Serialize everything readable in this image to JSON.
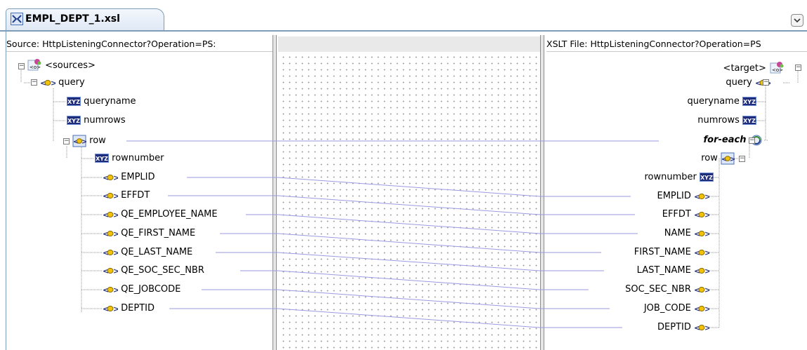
{
  "tab": {
    "title": "EMPL_DEPT_1.xsl"
  },
  "source_pane": {
    "header": "Source: HttpListeningConnector?Operation=PS:",
    "nodes": {
      "sources": "<sources>",
      "query": "query",
      "queryname": "queryname",
      "numrows": "numrows",
      "row": "row",
      "rownumber": "rownumber",
      "emplid": "EMPLID",
      "effdt": "EFFDT",
      "employee_name": "QE_EMPLOYEE_NAME",
      "first_name": "QE_FIRST_NAME",
      "last_name": "QE_LAST_NAME",
      "soc_sec_nbr": "QE_SOC_SEC_NBR",
      "jobcode": "QE_JOBCODE",
      "deptid": "DEPTID"
    }
  },
  "target_pane": {
    "header": "XSLT File: HttpListeningConnector?Operation=PS",
    "nodes": {
      "target": "<target>",
      "query": "query",
      "queryname": "queryname",
      "numrows": "numrows",
      "for_each": "for-each",
      "row": "row",
      "rownumber": "rownumber",
      "emplid": "EMPLID",
      "effdt": "EFFDT",
      "name": "NAME",
      "first_name": "FIRST_NAME",
      "last_name": "LAST_NAME",
      "soc_sec_nbr": "SOC_SEC_NBR",
      "job_code": "JOB_CODE",
      "deptid": "DEPTID"
    }
  },
  "icons": {
    "xyz_label": "XYZ",
    "element_icon": "element-icon",
    "attribute_icon": "leaf-xyz-icon",
    "for_each_icon": "for-each-icon",
    "root_icon": "schema-root-icon"
  },
  "colors": {
    "mapping_line": "#9a9ae0",
    "grid_dot": "#9a9a9a",
    "tab_border": "#7f9db9"
  }
}
